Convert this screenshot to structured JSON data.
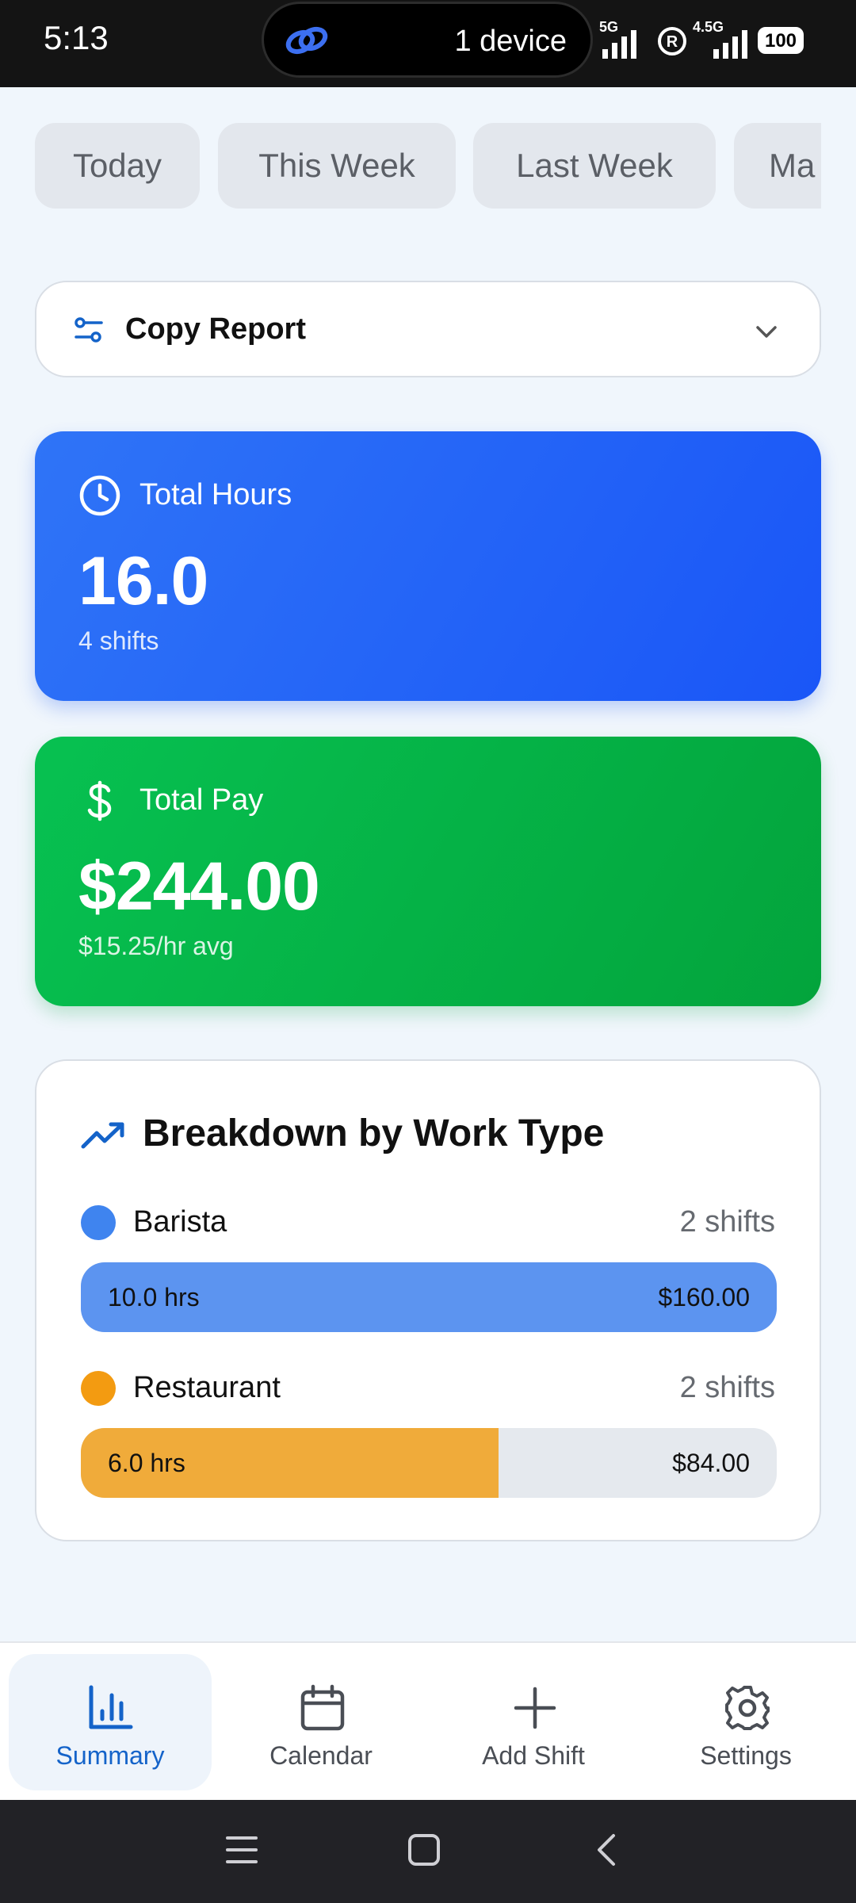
{
  "status_bar": {
    "time": "5:13",
    "pill_text": "1 device",
    "net1": "5G",
    "net2": "4.5G",
    "battery": "100"
  },
  "filters": {
    "chips": [
      "Today",
      "This Week",
      "Last Week",
      "Ma"
    ]
  },
  "report_dropdown": {
    "label": "Copy Report"
  },
  "total_hours": {
    "label": "Total Hours",
    "value": "16.0",
    "sub": "4 shifts"
  },
  "total_pay": {
    "label": "Total Pay",
    "value": "$244.00",
    "sub": "$15.25/hr avg"
  },
  "breakdown": {
    "title": "Breakdown by Work Type",
    "rows": [
      {
        "name": "Barista",
        "count": "2 shifts",
        "hours": "10.0 hrs",
        "pay": "$160.00",
        "fill_fraction": 1.0,
        "color": "#5c94f0",
        "dot_color": "#3f84ef"
      },
      {
        "name": "Restaurant",
        "count": "2 shifts",
        "hours": "6.0 hrs",
        "pay": "$84.00",
        "fill_fraction": 0.6,
        "color": "#f0ab3a",
        "dot_color": "#f39b11"
      }
    ]
  },
  "bottom_nav": {
    "items": [
      {
        "label": "Summary",
        "icon": "bar-chart-icon",
        "active": true
      },
      {
        "label": "Calendar",
        "icon": "calendar-icon",
        "active": false
      },
      {
        "label": "Add Shift",
        "icon": "plus-icon",
        "active": false
      },
      {
        "label": "Settings",
        "icon": "gear-icon",
        "active": false
      }
    ]
  },
  "colors": {
    "accent_blue": "#1a56f7",
    "accent_green": "#03a43c",
    "active_nav": "#1463c9"
  }
}
